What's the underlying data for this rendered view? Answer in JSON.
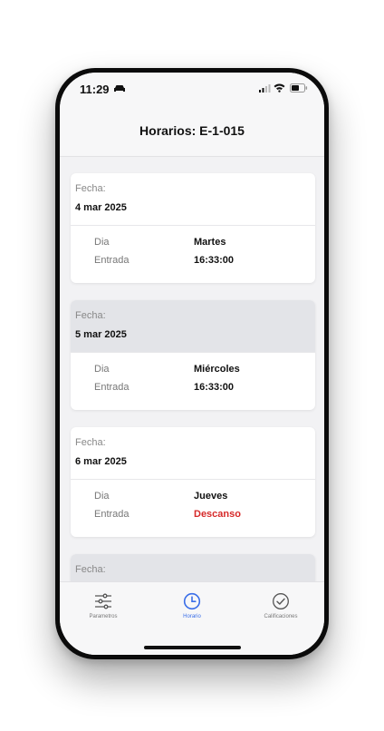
{
  "status_bar": {
    "time": "11:29"
  },
  "header": {
    "title": "Horarios: E-1-015"
  },
  "schedule": [
    {
      "fecha_label": "Fecha:",
      "fecha": "4 mar 2025",
      "dia_label": "Dia",
      "dia": "Martes",
      "entrada_label": "Entrada",
      "entrada": "16:33:00",
      "highlighted": false,
      "rest": false
    },
    {
      "fecha_label": "Fecha:",
      "fecha": "5 mar 2025",
      "dia_label": "Dia",
      "dia": "Miércoles",
      "entrada_label": "Entrada",
      "entrada": "16:33:00",
      "highlighted": true,
      "rest": false
    },
    {
      "fecha_label": "Fecha:",
      "fecha": "6 mar 2025",
      "dia_label": "Dia",
      "dia": "Jueves",
      "entrada_label": "Entrada",
      "entrada": "Descanso",
      "highlighted": false,
      "rest": true
    },
    {
      "fecha_label": "Fecha:",
      "highlighted": true
    }
  ],
  "tabs": [
    {
      "label": "Parametros",
      "icon": "sliders-icon",
      "active": false
    },
    {
      "label": "Horario",
      "icon": "clock-icon",
      "active": true
    },
    {
      "label": "Calificaciones",
      "icon": "check-circle-icon",
      "active": false
    }
  ],
  "colors": {
    "accent": "#3a6ee8",
    "rest": "#d62a2a",
    "highlight_bg": "#e3e4e8"
  }
}
